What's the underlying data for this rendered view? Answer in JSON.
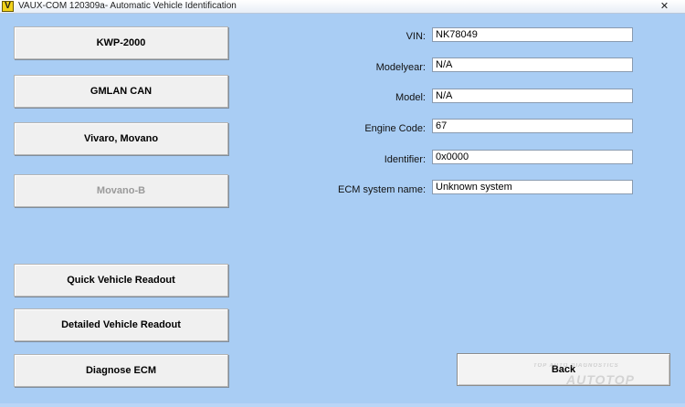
{
  "window": {
    "icon_letter": "V",
    "title": "VAUX-COM 120309a- Automatic Vehicle Identification",
    "close_glyph": "✕"
  },
  "buttons": [
    {
      "label": "KWP-2000",
      "enabled": true
    },
    {
      "label": "GMLAN CAN",
      "enabled": true
    },
    {
      "label": "Vivaro, Movano",
      "enabled": true
    },
    {
      "label": "Movano-B",
      "enabled": false
    },
    {
      "label": "Quick Vehicle Readout",
      "enabled": true
    },
    {
      "label": "Detailed Vehicle Readout",
      "enabled": true
    },
    {
      "label": "Diagnose ECM",
      "enabled": true
    }
  ],
  "fields": [
    {
      "label": "VIN:",
      "value": "NK78049"
    },
    {
      "label": "Modelyear:",
      "value": "N/A"
    },
    {
      "label": "Model:",
      "value": "N/A"
    },
    {
      "label": "Engine Code:",
      "value": "67"
    },
    {
      "label": "Identifier:",
      "value": "0x0000"
    },
    {
      "label": "ECM system name:",
      "value": "Unknown system"
    }
  ],
  "back_button": {
    "label": "Back"
  },
  "watermark": {
    "small": "TOP AUTO DIAGNOSTICS",
    "big": "AUTOTOP"
  },
  "colors": {
    "background": "#a9cdf4",
    "button_face": "#f0f0f0",
    "disabled_text": "#9a9a9a"
  }
}
